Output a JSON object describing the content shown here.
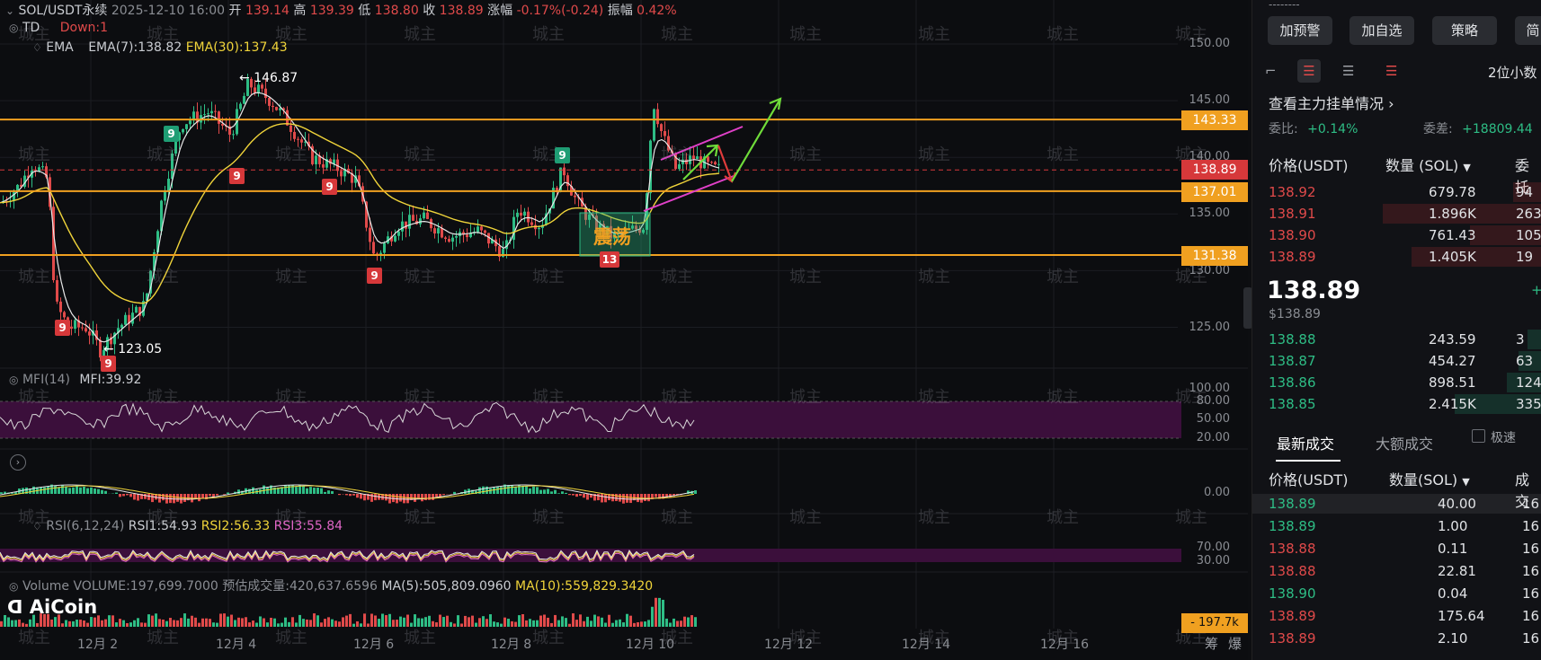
{
  "header": {
    "symbol": "SOL/USDT永续",
    "datetime": "2025-12-10 16:00",
    "open_label": "开",
    "open": "139.14",
    "high_label": "高",
    "high": "139.39",
    "low_label": "低",
    "low": "138.80",
    "close_label": "收",
    "close": "138.89",
    "change_label": "涨幅",
    "change": "-0.17%(-0.24)",
    "amp_label": "振幅",
    "amp": "0.42%",
    "td_label": "TD",
    "td_value": "Down:1",
    "ema_label": "EMA",
    "ema7": "EMA(7):138.82",
    "ema30": "EMA(30):137.43"
  },
  "price_axis": [
    "150.00",
    "145.00",
    "140.00",
    "135.00",
    "130.00",
    "125.00"
  ],
  "levels": [
    {
      "value": "143.33",
      "color": "#f0a020"
    },
    {
      "value": "138.89",
      "color": "#d6383a"
    },
    {
      "value": "137.01",
      "color": "#f0a020"
    },
    {
      "value": "131.38",
      "color": "#f0a020"
    }
  ],
  "annotations": {
    "high_marker": "146.87",
    "low_marker": "123.05",
    "box_text": "震荡"
  },
  "td_badges": [
    {
      "n": "9",
      "kind": "g"
    },
    {
      "n": "9",
      "kind": "r"
    },
    {
      "n": "9",
      "kind": "r"
    },
    {
      "n": "9",
      "kind": "g"
    },
    {
      "n": "9",
      "kind": "r"
    },
    {
      "n": "9",
      "kind": "r"
    },
    {
      "n": "9",
      "kind": "r"
    },
    {
      "n": "13",
      "kind": "r"
    }
  ],
  "mfi": {
    "label": "MFI(14)",
    "value": "MFI:39.92",
    "axis": [
      "100.00",
      "80.00",
      "50.00",
      "20.00"
    ]
  },
  "macd": {
    "axis": "0.00"
  },
  "rsi": {
    "label": "RSI(6,12,24)",
    "rsi1": "RSI1:54.93",
    "rsi2": "RSI2:56.33",
    "rsi3": "RSI3:55.84",
    "axis": [
      "70.00",
      "30.00"
    ]
  },
  "volume": {
    "label": "Volume",
    "value": "VOLUME:197,699.7000",
    "est": "预估成交量:420,637.6596",
    "ma5": "MA(5):505,809.0960",
    "ma10": "MA(10):559,829.3420",
    "tag": "197.7k"
  },
  "logo": "AiCoin",
  "dates": [
    "12月 2",
    "12月 4",
    "12月 6",
    "12月 8",
    "12月 10",
    "12月 12",
    "12月 14",
    "12月 16"
  ],
  "bottom_right": [
    "筹",
    "爆"
  ],
  "watermark": "城主",
  "side": {
    "dashes": "--------",
    "buttons": [
      "加预警",
      "加自选",
      "策略",
      "简"
    ],
    "decimals": "2位小数",
    "main_orders": "查看主力挂单情况",
    "weibi_label": "委比:",
    "weibi": "+0.14%",
    "weicha_label": "委差:",
    "weicha": "+18809.44",
    "book_headers": [
      "价格(USDT)",
      "数量 (SOL)",
      "委托"
    ],
    "asks": [
      {
        "price": "138.92",
        "qty": "679.78",
        "total": "94",
        "depth": 0.1
      },
      {
        "price": "138.91",
        "qty": "1.896K",
        "total": "263",
        "depth": 0.55
      },
      {
        "price": "138.90",
        "qty": "761.43",
        "total": "105",
        "depth": 0.25
      },
      {
        "price": "138.89",
        "qty": "1.405K",
        "total": "19",
        "depth": 0.45
      }
    ],
    "last_price": "138.89",
    "last_usd": "$138.89",
    "last_right_top": "+",
    "bids": [
      {
        "price": "138.88",
        "qty": "243.59",
        "total": "3",
        "depth": 0.05
      },
      {
        "price": "138.87",
        "qty": "454.27",
        "total": "63",
        "depth": 0.08
      },
      {
        "price": "138.86",
        "qty": "898.51",
        "total": "124",
        "depth": 0.12
      },
      {
        "price": "138.85",
        "qty": "2.415K",
        "total": "335",
        "depth": 0.3
      }
    ],
    "tabs": [
      "最新成交",
      "大额成交"
    ],
    "fast_label": "极速",
    "trade_headers": [
      "价格(USDT)",
      "数量(SOL)",
      "成交"
    ],
    "trades": [
      {
        "price": "138.89",
        "qty": "40.00",
        "time": "16",
        "side": "buy"
      },
      {
        "price": "138.89",
        "qty": "1.00",
        "time": "16",
        "side": "buy"
      },
      {
        "price": "138.88",
        "qty": "0.11",
        "time": "16",
        "side": "sell"
      },
      {
        "price": "138.88",
        "qty": "22.81",
        "time": "16",
        "side": "sell"
      },
      {
        "price": "138.90",
        "qty": "0.04",
        "time": "16",
        "side": "buy"
      },
      {
        "price": "138.89",
        "qty": "175.64",
        "time": "16",
        "side": "sell"
      },
      {
        "price": "138.89",
        "qty": "2.10",
        "time": "16",
        "side": "sell"
      }
    ]
  }
}
